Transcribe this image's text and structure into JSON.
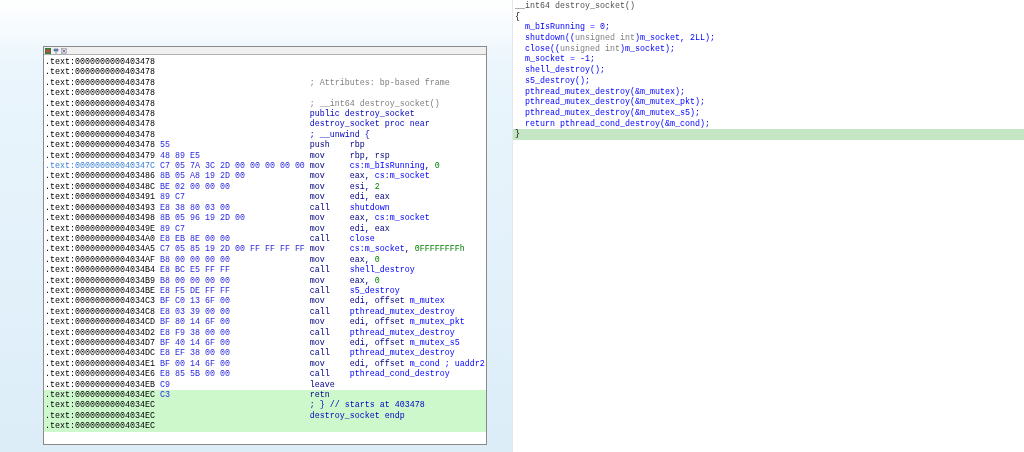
{
  "disassembly": {
    "rows": [
      {
        "address": ".text:0000000000403478",
        "kind": "empty",
        "highlighted": false,
        "current": false
      },
      {
        "address": ".text:0000000000403478",
        "kind": "empty",
        "highlighted": false,
        "current": false
      },
      {
        "address": ".text:0000000000403478",
        "kind": "comment",
        "text": "; Attributes: bp-based frame",
        "highlighted": false,
        "current": false
      },
      {
        "address": ".text:0000000000403478",
        "kind": "empty",
        "highlighted": false,
        "current": false
      },
      {
        "address": ".text:0000000000403478",
        "kind": "comment",
        "text": "; __int64 destroy_socket()",
        "highlighted": false,
        "current": false
      },
      {
        "address": ".text:0000000000403478",
        "kind": "directive",
        "text": "public destroy_socket",
        "highlighted": false,
        "current": false
      },
      {
        "address": ".text:0000000000403478",
        "kind": "directive",
        "text": "destroy_socket proc near",
        "highlighted": false,
        "current": false
      },
      {
        "address": ".text:0000000000403478",
        "kind": "directive",
        "text": "; __unwind {",
        "highlighted": false,
        "current": false
      },
      {
        "address": ".text:0000000000403478",
        "bytes": "55",
        "kind": "instruction",
        "mnemonic": "push",
        "operands": [
          {
            "kind": "reg",
            "text": "rbp"
          }
        ],
        "highlighted": false,
        "current": false
      },
      {
        "address": ".text:0000000000403479",
        "bytes": "48 89 E5",
        "kind": "instruction",
        "mnemonic": "mov",
        "operands": [
          {
            "kind": "reg",
            "text": "rbp, rsp"
          }
        ],
        "highlighted": false,
        "current": false
      },
      {
        "address": ".text:000000000040347C",
        "bytes": "C7 05 7A 3C 2D 00 00 00 00 00",
        "kind": "instruction",
        "mnemonic": "mov",
        "operands": [
          {
            "kind": "name",
            "text": "cs:m_bIsRunning"
          },
          {
            "kind": "reg",
            "text": ", "
          },
          {
            "kind": "number",
            "text": "0"
          }
        ],
        "highlighted": false,
        "current": true
      },
      {
        "address": ".text:0000000000403486",
        "bytes": "8B 05 A8 19 2D 00",
        "kind": "instruction",
        "mnemonic": "mov",
        "operands": [
          {
            "kind": "reg",
            "text": "eax, "
          },
          {
            "kind": "name",
            "text": "cs:m_socket"
          }
        ],
        "highlighted": false,
        "current": false
      },
      {
        "address": ".text:000000000040348C",
        "bytes": "BE 02 00 00 00",
        "kind": "instruction",
        "mnemonic": "mov",
        "operands": [
          {
            "kind": "reg",
            "text": "esi, "
          },
          {
            "kind": "number",
            "text": "2"
          }
        ],
        "highlighted": false,
        "current": false
      },
      {
        "address": ".text:0000000000403491",
        "bytes": "89 C7",
        "kind": "instruction",
        "mnemonic": "mov",
        "operands": [
          {
            "kind": "reg",
            "text": "edi, eax"
          }
        ],
        "highlighted": false,
        "current": false
      },
      {
        "address": ".text:0000000000403493",
        "bytes": "E8 38 80 03 00",
        "kind": "instruction",
        "mnemonic": "call",
        "operands": [
          {
            "kind": "name",
            "text": "shutdown"
          }
        ],
        "highlighted": false,
        "current": false
      },
      {
        "address": ".text:0000000000403498",
        "bytes": "8B 05 96 19 2D 00",
        "kind": "instruction",
        "mnemonic": "mov",
        "operands": [
          {
            "kind": "reg",
            "text": "eax, "
          },
          {
            "kind": "name",
            "text": "cs:m_socket"
          }
        ],
        "highlighted": false,
        "current": false
      },
      {
        "address": ".text:000000000040349E",
        "bytes": "89 C7",
        "kind": "instruction",
        "mnemonic": "mov",
        "operands": [
          {
            "kind": "reg",
            "text": "edi, eax"
          }
        ],
        "highlighted": false,
        "current": false
      },
      {
        "address": ".text:00000000004034A0",
        "bytes": "E8 EB 8E 00 00",
        "kind": "instruction",
        "mnemonic": "call",
        "operands": [
          {
            "kind": "name",
            "text": "close"
          }
        ],
        "highlighted": false,
        "current": false
      },
      {
        "address": ".text:00000000004034A5",
        "bytes": "C7 05 85 19 2D 00 FF FF FF FF",
        "kind": "instruction",
        "mnemonic": "mov",
        "operands": [
          {
            "kind": "name",
            "text": "cs:m_socket"
          },
          {
            "kind": "reg",
            "text": ", "
          },
          {
            "kind": "number",
            "text": "0FFFFFFFFh"
          }
        ],
        "highlighted": false,
        "current": false
      },
      {
        "address": ".text:00000000004034AF",
        "bytes": "B8 00 00 00 00",
        "kind": "instruction",
        "mnemonic": "mov",
        "operands": [
          {
            "kind": "reg",
            "text": "eax, "
          },
          {
            "kind": "number",
            "text": "0"
          }
        ],
        "highlighted": false,
        "current": false
      },
      {
        "address": ".text:00000000004034B4",
        "bytes": "E8 BC E5 FF FF",
        "kind": "instruction",
        "mnemonic": "call",
        "operands": [
          {
            "kind": "name",
            "text": "shell_destroy"
          }
        ],
        "highlighted": false,
        "current": false
      },
      {
        "address": ".text:00000000004034B9",
        "bytes": "B8 00 00 00 00",
        "kind": "instruction",
        "mnemonic": "mov",
        "operands": [
          {
            "kind": "reg",
            "text": "eax, "
          },
          {
            "kind": "number",
            "text": "0"
          }
        ],
        "highlighted": false,
        "current": false
      },
      {
        "address": ".text:00000000004034BE",
        "bytes": "E8 F5 DE FF FF",
        "kind": "instruction",
        "mnemonic": "call",
        "operands": [
          {
            "kind": "name",
            "text": "s5_destroy"
          }
        ],
        "highlighted": false,
        "current": false
      },
      {
        "address": ".text:00000000004034C3",
        "bytes": "BF C0 13 6F 00",
        "kind": "instruction",
        "mnemonic": "mov",
        "operands": [
          {
            "kind": "reg",
            "text": "edi, offset "
          },
          {
            "kind": "name",
            "text": "m_mutex"
          }
        ],
        "highlighted": false,
        "current": false
      },
      {
        "address": ".text:00000000004034C8",
        "bytes": "E8 03 39 00 00",
        "kind": "instruction",
        "mnemonic": "call",
        "operands": [
          {
            "kind": "name",
            "text": "pthread_mutex_destroy"
          }
        ],
        "highlighted": false,
        "current": false
      },
      {
        "address": ".text:00000000004034CD",
        "bytes": "BF 80 14 6F 00",
        "kind": "instruction",
        "mnemonic": "mov",
        "operands": [
          {
            "kind": "reg",
            "text": "edi, offset "
          },
          {
            "kind": "name",
            "text": "m_mutex_pkt"
          }
        ],
        "highlighted": false,
        "current": false
      },
      {
        "address": ".text:00000000004034D2",
        "bytes": "E8 F9 38 00 00",
        "kind": "instruction",
        "mnemonic": "call",
        "operands": [
          {
            "kind": "name",
            "text": "pthread_mutex_destroy"
          }
        ],
        "highlighted": false,
        "current": false
      },
      {
        "address": ".text:00000000004034D7",
        "bytes": "BF 40 14 6F 00",
        "kind": "instruction",
        "mnemonic": "mov",
        "operands": [
          {
            "kind": "reg",
            "text": "edi, offset "
          },
          {
            "kind": "name",
            "text": "m_mutex_s5"
          }
        ],
        "highlighted": false,
        "current": false
      },
      {
        "address": ".text:00000000004034DC",
        "bytes": "E8 EF 38 00 00",
        "kind": "instruction",
        "mnemonic": "call",
        "operands": [
          {
            "kind": "name",
            "text": "pthread_mutex_destroy"
          }
        ],
        "highlighted": false,
        "current": false
      },
      {
        "address": ".text:00000000004034E1",
        "bytes": "BF 00 14 6F 00",
        "kind": "instruction",
        "mnemonic": "mov",
        "operands": [
          {
            "kind": "reg",
            "text": "edi, offset "
          },
          {
            "kind": "name",
            "text": "m_cond ; uaddr2"
          }
        ],
        "highlighted": false,
        "current": false
      },
      {
        "address": ".text:00000000004034E6",
        "bytes": "E8 85 5B 00 00",
        "kind": "instruction",
        "mnemonic": "call",
        "operands": [
          {
            "kind": "name",
            "text": "pthread_cond_destroy"
          }
        ],
        "highlighted": false,
        "current": false
      },
      {
        "address": ".text:00000000004034EB",
        "bytes": "C9",
        "kind": "instruction",
        "mnemonic": "leave",
        "highlighted": false,
        "current": false
      },
      {
        "address": ".text:00000000004034EC",
        "bytes": "C3",
        "kind": "instruction",
        "mnemonic": "retn",
        "highlighted": true,
        "current": false
      },
      {
        "address": ".text:00000000004034EC",
        "kind": "directive",
        "text": "; } // starts at 403478",
        "highlighted": true,
        "current": false
      },
      {
        "address": ".text:00000000004034EC",
        "kind": "directive",
        "text": "destroy_socket endp",
        "highlighted": true,
        "current": false
      },
      {
        "address": ".text:00000000004034EC",
        "kind": "empty",
        "highlighted": true,
        "current": false
      }
    ]
  },
  "pseudocode": {
    "lines": [
      {
        "highlighted": false,
        "parts": [
          {
            "kind": "header",
            "text": "__int64 destroy_socket()"
          }
        ]
      },
      {
        "highlighted": false,
        "parts": [
          {
            "kind": "punct",
            "text": "{"
          }
        ]
      },
      {
        "highlighted": false,
        "parts": [
          {
            "kind": "code",
            "text": "  m_bIsRunning = 0;"
          }
        ]
      },
      {
        "highlighted": false,
        "parts": [
          {
            "kind": "code",
            "text": "  shutdown(("
          },
          {
            "kind": "type",
            "text": "unsigned int"
          },
          {
            "kind": "code",
            "text": ")m_socket, 2LL);"
          }
        ]
      },
      {
        "highlighted": false,
        "parts": [
          {
            "kind": "code",
            "text": "  close(("
          },
          {
            "kind": "type",
            "text": "unsigned int"
          },
          {
            "kind": "code",
            "text": ")m_socket);"
          }
        ]
      },
      {
        "highlighted": false,
        "parts": [
          {
            "kind": "code",
            "text": "  m_socket = -1;"
          }
        ]
      },
      {
        "highlighted": false,
        "parts": [
          {
            "kind": "code",
            "text": "  shell_destroy();"
          }
        ]
      },
      {
        "highlighted": false,
        "parts": [
          {
            "kind": "code",
            "text": "  s5_destroy();"
          }
        ]
      },
      {
        "highlighted": false,
        "parts": [
          {
            "kind": "code",
            "text": "  pthread_mutex_destroy(&m_mutex);"
          }
        ]
      },
      {
        "highlighted": false,
        "parts": [
          {
            "kind": "code",
            "text": "  pthread_mutex_destroy(&m_mutex_pkt);"
          }
        ]
      },
      {
        "highlighted": false,
        "parts": [
          {
            "kind": "code",
            "text": "  pthread_mutex_destroy(&m_mutex_s5);"
          }
        ]
      },
      {
        "highlighted": false,
        "parts": [
          {
            "kind": "code",
            "text": "  return pthread_cond_destroy(&m_cond);"
          }
        ]
      },
      {
        "highlighted": true,
        "parts": [
          {
            "kind": "punct",
            "text": "}"
          }
        ]
      }
    ]
  }
}
